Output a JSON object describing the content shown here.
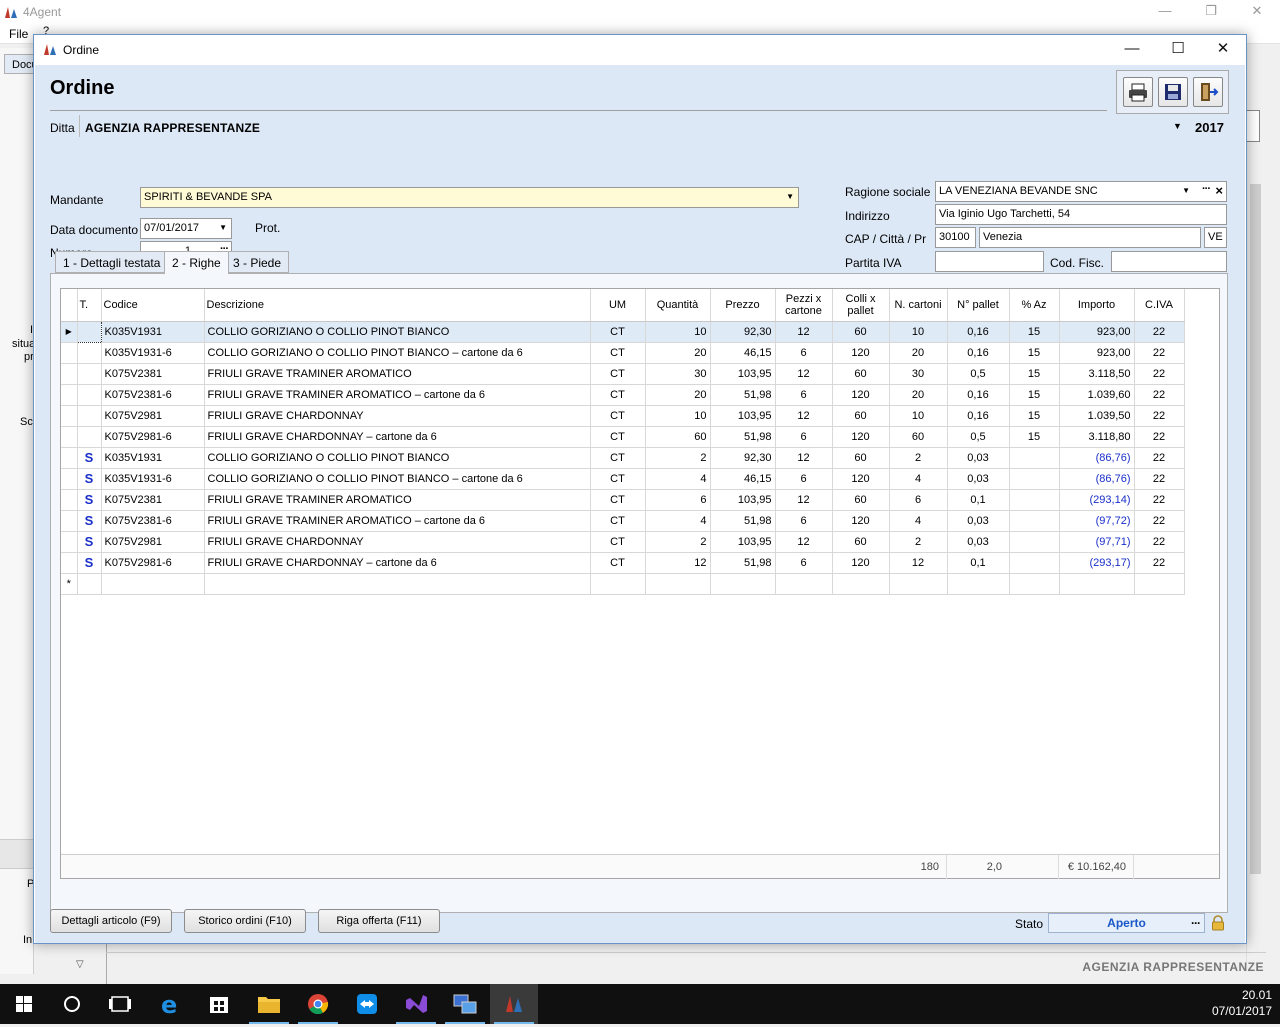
{
  "app": {
    "title": "4Agent",
    "menu_file": "File",
    "menu_help": "?",
    "left_tab": "Docu",
    "left_fragments": [
      "I",
      "situa",
      "pr",
      "Sc",
      "D",
      "P",
      "In"
    ],
    "footer_company": "AGENZIA RAPPRESENTANZE",
    "window_controls": [
      "minimize-icon",
      "restore-icon",
      "close-icon"
    ]
  },
  "dialog": {
    "title": "Ordine",
    "heading": "Ordine",
    "toolbar_icons": [
      "printer-icon",
      "save-icon",
      "exit-icon"
    ],
    "ditta": {
      "label": "Ditta",
      "value": "AGENZIA RAPPRESENTANZE",
      "year": "2017"
    },
    "mandante": {
      "label": "Mandante",
      "value": "SPIRITI & BEVANDE SPA"
    },
    "data_documento": {
      "label": "Data documento",
      "value": "07/01/2017"
    },
    "prot": {
      "label": "Prot."
    },
    "numero": {
      "label": "Numero",
      "value": "1"
    },
    "ragione_sociale": {
      "label": "Ragione sociale",
      "value": "LA VENEZIANA BEVANDE SNC"
    },
    "indirizzo": {
      "label": "Indirizzo",
      "value": "Via Iginio Ugo Tarchetti, 54"
    },
    "cap_citta": {
      "label": "CAP / Città / Pr",
      "cap": "30100",
      "citta": "Venezia",
      "pr": "VE"
    },
    "partita_iva": {
      "label": "Partita IVA",
      "value": ""
    },
    "cod_fisc": {
      "label": "Cod. Fisc.",
      "value": ""
    },
    "tabs": [
      {
        "label": "1 - Dettagli testata"
      },
      {
        "label": "2 - Righe"
      },
      {
        "label": "3 - Piede"
      }
    ],
    "grid": {
      "columns": [
        "T.",
        "Codice",
        "Descrizione",
        "UM",
        "Quantità",
        "Prezzo",
        "Pezzi x cartone",
        "Colli x pallet",
        "N. cartoni",
        "N° pallet",
        "% Az",
        "Importo",
        "C.IVA"
      ],
      "rows": [
        {
          "t": "",
          "codice": "K035V1931",
          "descrizione": "COLLIO GORIZIANO O COLLIO PINOT BIANCO",
          "um": "CT",
          "quantita": "10",
          "prezzo": "92,30",
          "pezzi": "12",
          "colli": "60",
          "cartoni": "10",
          "pallet": "0,16",
          "az": "15",
          "importo": "923,00",
          "iva": "22",
          "neg": false
        },
        {
          "t": "",
          "codice": "K035V1931-6",
          "descrizione": "COLLIO GORIZIANO O COLLIO PINOT BIANCO – cartone da 6",
          "um": "CT",
          "quantita": "20",
          "prezzo": "46,15",
          "pezzi": "6",
          "colli": "120",
          "cartoni": "20",
          "pallet": "0,16",
          "az": "15",
          "importo": "923,00",
          "iva": "22",
          "neg": false
        },
        {
          "t": "",
          "codice": "K075V2381",
          "descrizione": "FRIULI GRAVE TRAMINER AROMATICO",
          "um": "CT",
          "quantita": "30",
          "prezzo": "103,95",
          "pezzi": "12",
          "colli": "60",
          "cartoni": "30",
          "pallet": "0,5",
          "az": "15",
          "importo": "3.118,50",
          "iva": "22",
          "neg": false
        },
        {
          "t": "",
          "codice": "K075V2381-6",
          "descrizione": "FRIULI GRAVE TRAMINER AROMATICO – cartone da 6",
          "um": "CT",
          "quantita": "20",
          "prezzo": "51,98",
          "pezzi": "6",
          "colli": "120",
          "cartoni": "20",
          "pallet": "0,16",
          "az": "15",
          "importo": "1.039,60",
          "iva": "22",
          "neg": false
        },
        {
          "t": "",
          "codice": "K075V2981",
          "descrizione": "FRIULI GRAVE CHARDONNAY",
          "um": "CT",
          "quantita": "10",
          "prezzo": "103,95",
          "pezzi": "12",
          "colli": "60",
          "cartoni": "10",
          "pallet": "0,16",
          "az": "15",
          "importo": "1.039,50",
          "iva": "22",
          "neg": false
        },
        {
          "t": "",
          "codice": "K075V2981-6",
          "descrizione": "FRIULI GRAVE CHARDONNAY – cartone da 6",
          "um": "CT",
          "quantita": "60",
          "prezzo": "51,98",
          "pezzi": "6",
          "colli": "120",
          "cartoni": "60",
          "pallet": "0,5",
          "az": "15",
          "importo": "3.118,80",
          "iva": "22",
          "neg": false
        },
        {
          "t": "S",
          "codice": "K035V1931",
          "descrizione": "COLLIO GORIZIANO O COLLIO PINOT BIANCO",
          "um": "CT",
          "quantita": "2",
          "prezzo": "92,30",
          "pezzi": "12",
          "colli": "60",
          "cartoni": "2",
          "pallet": "0,03",
          "az": "",
          "importo": "(86,76)",
          "iva": "22",
          "neg": true
        },
        {
          "t": "S",
          "codice": "K035V1931-6",
          "descrizione": "COLLIO GORIZIANO O COLLIO PINOT BIANCO – cartone da 6",
          "um": "CT",
          "quantita": "4",
          "prezzo": "46,15",
          "pezzi": "6",
          "colli": "120",
          "cartoni": "4",
          "pallet": "0,03",
          "az": "",
          "importo": "(86,76)",
          "iva": "22",
          "neg": true
        },
        {
          "t": "S",
          "codice": "K075V2381",
          "descrizione": "FRIULI GRAVE TRAMINER AROMATICO",
          "um": "CT",
          "quantita": "6",
          "prezzo": "103,95",
          "pezzi": "12",
          "colli": "60",
          "cartoni": "6",
          "pallet": "0,1",
          "az": "",
          "importo": "(293,14)",
          "iva": "22",
          "neg": true
        },
        {
          "t": "S",
          "codice": "K075V2381-6",
          "descrizione": "FRIULI GRAVE TRAMINER AROMATICO – cartone da 6",
          "um": "CT",
          "quantita": "4",
          "prezzo": "51,98",
          "pezzi": "6",
          "colli": "120",
          "cartoni": "4",
          "pallet": "0,03",
          "az": "",
          "importo": "(97,72)",
          "iva": "22",
          "neg": true
        },
        {
          "t": "S",
          "codice": "K075V2981",
          "descrizione": "FRIULI GRAVE CHARDONNAY",
          "um": "CT",
          "quantita": "2",
          "prezzo": "103,95",
          "pezzi": "12",
          "colli": "60",
          "cartoni": "2",
          "pallet": "0,03",
          "az": "",
          "importo": "(97,71)",
          "iva": "22",
          "neg": true
        },
        {
          "t": "S",
          "codice": "K075V2981-6",
          "descrizione": "FRIULI GRAVE CHARDONNAY – cartone da 6",
          "um": "CT",
          "quantita": "12",
          "prezzo": "51,98",
          "pezzi": "6",
          "colli": "120",
          "cartoni": "12",
          "pallet": "0,1",
          "az": "",
          "importo": "(293,17)",
          "iva": "22",
          "neg": true
        }
      ],
      "totals": {
        "cartoni": "180",
        "pallet": "2,0",
        "importo": "€ 10.162,40"
      }
    },
    "buttons": {
      "dettagli": "Dettagli articolo (F9)",
      "storico": "Storico ordini (F10)",
      "riga_offerta": "Riga offerta (F11)"
    },
    "stato": {
      "label": "Stato",
      "value": "Aperto"
    }
  },
  "taskbar": {
    "icons": [
      "windows-start-icon",
      "search-icon",
      "task-view-icon",
      "edge-icon",
      "store-icon",
      "file-explorer-icon",
      "chrome-icon",
      "teamviewer-icon",
      "visual-studio-icon",
      "remote-desktop-icon",
      "4agent-icon"
    ],
    "time": "20.01",
    "date": "07/01/2017"
  },
  "colors": {
    "accent": "#1a2fc9",
    "dialog_bg": "#dde8f7",
    "mandante_bg": "#fffbd6"
  }
}
